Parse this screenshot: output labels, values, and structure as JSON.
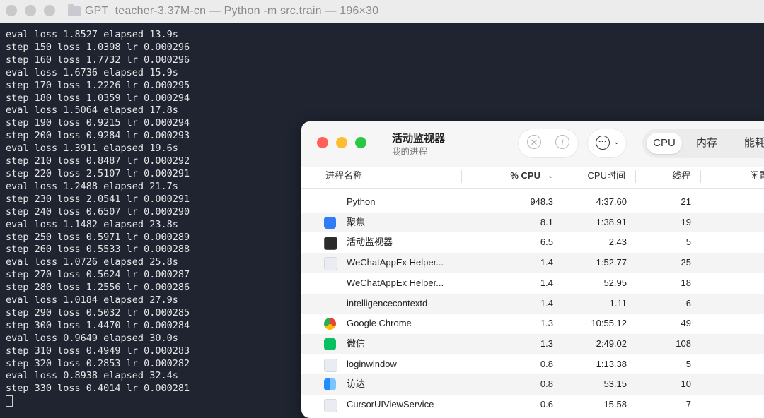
{
  "terminal": {
    "title": "GPT_teacher-3.37M-cn — Python -m src.train — 196×30",
    "lines": [
      "eval loss 1.8527 elapsed 13.9s",
      "step 150 loss 1.0398 lr 0.000296",
      "step 160 loss 1.7732 lr 0.000296",
      "eval loss 1.6736 elapsed 15.9s",
      "step 170 loss 1.2226 lr 0.000295",
      "step 180 loss 1.0359 lr 0.000294",
      "eval loss 1.5064 elapsed 17.8s",
      "step 190 loss 0.9215 lr 0.000294",
      "step 200 loss 0.9284 lr 0.000293",
      "eval loss 1.3911 elapsed 19.6s",
      "step 210 loss 0.8487 lr 0.000292",
      "step 220 loss 2.5107 lr 0.000291",
      "eval loss 1.2488 elapsed 21.7s",
      "step 230 loss 2.0541 lr 0.000291",
      "step 240 loss 0.6507 lr 0.000290",
      "eval loss 1.1482 elapsed 23.8s",
      "step 250 loss 0.5971 lr 0.000289",
      "step 260 loss 0.5533 lr 0.000288",
      "eval loss 1.0726 elapsed 25.8s",
      "step 270 loss 0.5624 lr 0.000287",
      "step 280 loss 1.2556 lr 0.000286",
      "eval loss 1.0184 elapsed 27.9s",
      "step 290 loss 0.5032 lr 0.000285",
      "step 300 loss 1.4470 lr 0.000284",
      "eval loss 0.9649 elapsed 30.0s",
      "step 310 loss 0.4949 lr 0.000283",
      "step 320 loss 0.2853 lr 0.000282",
      "eval loss 0.8938 elapsed 32.4s",
      "step 330 loss 0.4014 lr 0.000281"
    ]
  },
  "activity_monitor": {
    "title": "活动监视器",
    "subtitle": "我的进程",
    "tabs": [
      "CPU",
      "内存",
      "能耗"
    ],
    "active_tab": "CPU",
    "columns": {
      "name": "进程名称",
      "cpu": "% CPU",
      "cpu_time": "CPU时间",
      "threads": "线程",
      "idle": "闲置"
    },
    "rows": [
      {
        "name": "Python",
        "cpu": "948.3",
        "cpu_time": "4:37.60",
        "threads": "21",
        "icon": "none"
      },
      {
        "name": "聚焦",
        "cpu": "8.1",
        "cpu_time": "1:38.91",
        "threads": "19",
        "icon": "spotlight-icon"
      },
      {
        "name": "活动监视器",
        "cpu": "6.5",
        "cpu_time": "2.43",
        "threads": "5",
        "icon": "activity-monitor-icon"
      },
      {
        "name": "WeChatAppEx Helper...",
        "cpu": "1.4",
        "cpu_time": "1:52.77",
        "threads": "25",
        "icon": "generic-app-icon"
      },
      {
        "name": "WeChatAppEx Helper...",
        "cpu": "1.4",
        "cpu_time": "52.95",
        "threads": "18",
        "icon": "none"
      },
      {
        "name": "intelligencecontextd",
        "cpu": "1.4",
        "cpu_time": "1.11",
        "threads": "6",
        "icon": "none"
      },
      {
        "name": "Google Chrome",
        "cpu": "1.3",
        "cpu_time": "10:55.12",
        "threads": "49",
        "icon": "chrome-icon"
      },
      {
        "name": "微信",
        "cpu": "1.3",
        "cpu_time": "2:49.02",
        "threads": "108",
        "icon": "wechat-icon"
      },
      {
        "name": "loginwindow",
        "cpu": "0.8",
        "cpu_time": "1:13.38",
        "threads": "5",
        "icon": "generic-app-icon"
      },
      {
        "name": "访达",
        "cpu": "0.8",
        "cpu_time": "53.15",
        "threads": "10",
        "icon": "finder-icon"
      },
      {
        "name": "CursorUIViewService",
        "cpu": "0.6",
        "cpu_time": "15.58",
        "threads": "7",
        "icon": "generic-app-icon"
      }
    ]
  }
}
